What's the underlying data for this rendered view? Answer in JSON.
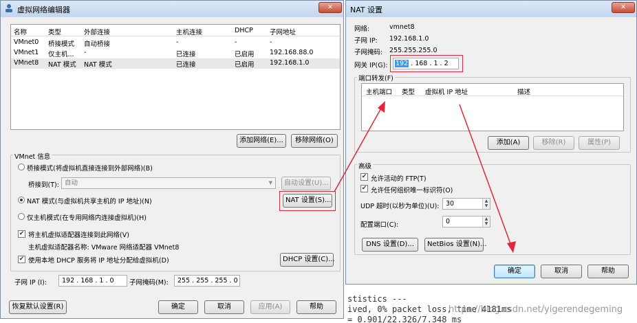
{
  "left_window": {
    "title": "虚拟网络编辑器",
    "network_table": {
      "headers": [
        "名称",
        "类型",
        "外部连接",
        "主机连接",
        "DHCP",
        "子网地址"
      ],
      "rows": [
        [
          "VMnet0",
          "桥接模式",
          "自动桥接",
          "-",
          "-",
          "-"
        ],
        [
          "VMnet1",
          "仅主机...",
          "-",
          "已连接",
          "已启用",
          "192.168.88.0"
        ],
        [
          "VMnet8",
          "NAT 模式",
          "NAT 模式",
          "已连接",
          "已启用",
          "192.168.1.0"
        ]
      ]
    },
    "add_network_button": "添加网络(E)...",
    "remove_network_button": "移除网络(O)",
    "vmnet_info_label": "VMnet 信息",
    "bridge_mode_radio": "桥接模式(将虚拟机直接连接到外部网络)(B)",
    "bridged_to_label": "桥接到(T):",
    "bridged_to_value": "自动",
    "auto_settings_button": "自动设置(U)...",
    "nat_mode_radio": "NAT 模式(与虚拟机共享主机的 IP 地址)(N)",
    "nat_settings_button": "NAT 设置(S)...",
    "host_only_radio": "仅主机模式(在专用网络内连接虚拟机)(H)",
    "connect_adapter_checkbox": "将主机虚拟适配器连接到此网络(V)",
    "adapter_name_text": "主机虚拟适配器名称: VMware 网络适配器 VMnet8",
    "use_dhcp_checkbox": "使用本地 DHCP 服务将 IP 地址分配给虚拟机(D)",
    "dhcp_settings_button": "DHCP 设置(C)...",
    "subnet_ip_label": "子网 IP (I):",
    "subnet_ip_value": "192 . 168 . 1 . 0",
    "subnet_mask_label": "子网掩码(M):",
    "subnet_mask_value": "255 . 255 . 255 . 0",
    "restore_defaults_button": "恢复默认设置(R)",
    "ok_button": "确定",
    "cancel_button": "取消",
    "apply_button": "应用(A)",
    "help_button": "帮助"
  },
  "nat_window": {
    "title": "NAT 设置",
    "network_label": "网络:",
    "network_value": "vmnet8",
    "subnet_ip_label": "子网 IP:",
    "subnet_ip_value": "192.168.1.0",
    "subnet_mask_label": "子网掩码:",
    "subnet_mask_value": "255.255.255.0",
    "gateway_label": "网关 IP(G):",
    "gateway_parts": [
      "192",
      "168",
      "1",
      "2"
    ],
    "port_forwarding_label": "端口转发(F)",
    "port_headers": [
      "主机端口",
      "类型",
      "虚拟机 IP 地址",
      "描述"
    ],
    "add_button": "添加(A)",
    "remove_button": "移除(R)",
    "properties_button": "属性(P)",
    "advanced_label": "高级",
    "allow_ftp_checkbox": "允许活动的 FTP(T)",
    "allow_any_oui_checkbox": "允许任何组织唯一标识符(O)",
    "udp_timeout_label": "UDP 超时(以秒为单位)(U):",
    "udp_timeout_value": "30",
    "config_port_label": "配置端口(C):",
    "config_port_value": "0",
    "dns_settings_button": "DNS 设置(D)...",
    "netbios_settings_button": "NetBios 设置(N)...",
    "ok_button": "确定",
    "cancel_button": "取消",
    "help_button": "帮助"
  },
  "terminal": {
    "line1": "stistics ---",
    "line2": "ived, 0% packet loss, time 4181ms",
    "line3": "= 0.901/22.326/7.348 ms"
  },
  "watermark": "https://blog.csdn.net/yigerendegeming",
  "colors": {
    "highlight": "#e3263a",
    "selection": "#3399ff"
  }
}
